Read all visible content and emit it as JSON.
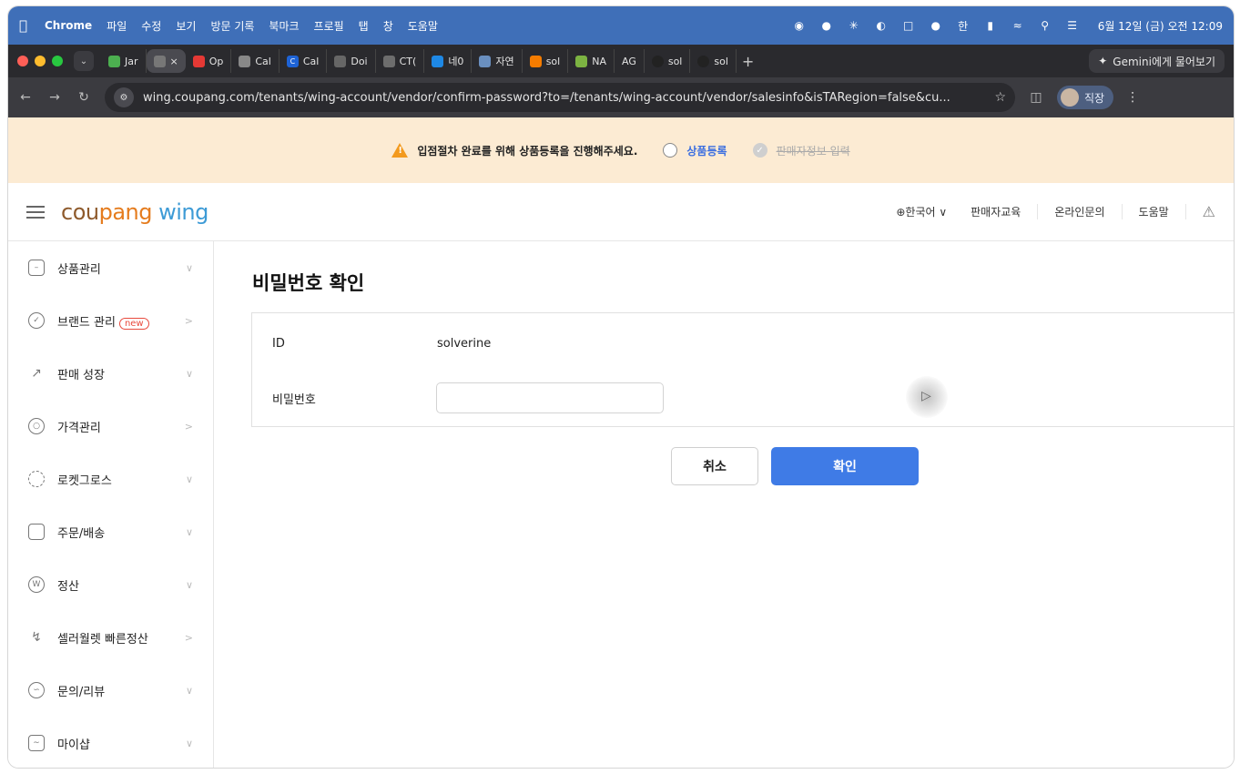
{
  "menubar": {
    "app": "Chrome",
    "items": [
      "파일",
      "수정",
      "보기",
      "방문 기록",
      "북마크",
      "프로필",
      "탭",
      "창",
      "도움말"
    ],
    "ime": "한",
    "clock": "6월 12일 (금) 오전 12:09"
  },
  "tabs": [
    {
      "label": "Jar",
      "color": "#4caf50"
    },
    {
      "label": "×",
      "color": "#777777",
      "active": true
    },
    {
      "label": "Op",
      "color": "#e53935"
    },
    {
      "label": "Cal",
      "color": "#888888"
    },
    {
      "label": "Cal",
      "color": "#1e63d6"
    },
    {
      "label": "Doi",
      "color": "#666666"
    },
    {
      "label": "CT(",
      "color": "#6d6d6d"
    },
    {
      "label": "네0",
      "color": "#1e88e5"
    },
    {
      "label": "자연",
      "color": "#6a8fbf"
    },
    {
      "label": "sol",
      "color": "#f57c00"
    },
    {
      "label": "NA",
      "color": "#7cb342"
    },
    {
      "label": "AG",
      "color": "#555555"
    },
    {
      "label": "sol",
      "color": "#222222"
    },
    {
      "label": "sol",
      "color": "#222222"
    }
  ],
  "gemini_label": "Gemini에게 물어보기",
  "address": {
    "url": "wing.coupang.com/tenants/wing-account/vendor/confirm-password?to=/tenants/wing-account/vendor/salesinfo&isTARegion=false&cu...",
    "profile_label": "직장"
  },
  "banner": {
    "message": "입점절차 완료를 위해 상품등록을 진행해주세요.",
    "step1": "상품등록",
    "step2": "판매자정보 입력"
  },
  "header": {
    "logo_part1": "cou",
    "logo_part2": "pang",
    "logo_part3": " wing",
    "language": "⊕한국어 ∨",
    "nav": [
      "판매자교육",
      "온라인문의",
      "도움말"
    ]
  },
  "sidebar": {
    "items": [
      {
        "label": "상품관리",
        "chev": "∨",
        "icon": "box-icon"
      },
      {
        "label": "브랜드 관리",
        "badge": "new",
        "chev": ">",
        "icon": "shield-icon"
      },
      {
        "label": "판매 성장",
        "chev": "∨",
        "icon": "trend-icon"
      },
      {
        "label": "가격관리",
        "chev": ">",
        "icon": "medal-icon"
      },
      {
        "label": "로켓그로스",
        "chev": "∨",
        "icon": "rocket-icon"
      },
      {
        "label": "주문/배송",
        "chev": "∨",
        "icon": "truck-icon"
      },
      {
        "label": "정산",
        "chev": "∨",
        "icon": "won-icon"
      },
      {
        "label": "셀러월렛 빠른정산",
        "chev": ">",
        "icon": "bolt-icon"
      },
      {
        "label": "문의/리뷰",
        "chev": "∨",
        "icon": "smile-icon"
      },
      {
        "label": "마이샵",
        "chev": "∨",
        "icon": "shop-icon"
      }
    ]
  },
  "main": {
    "title": "비밀번호 확인",
    "id_label": "ID",
    "id_value": "solverine",
    "password_label": "비밀번호",
    "password_value": "",
    "cancel_label": "취소",
    "confirm_label": "확인"
  }
}
